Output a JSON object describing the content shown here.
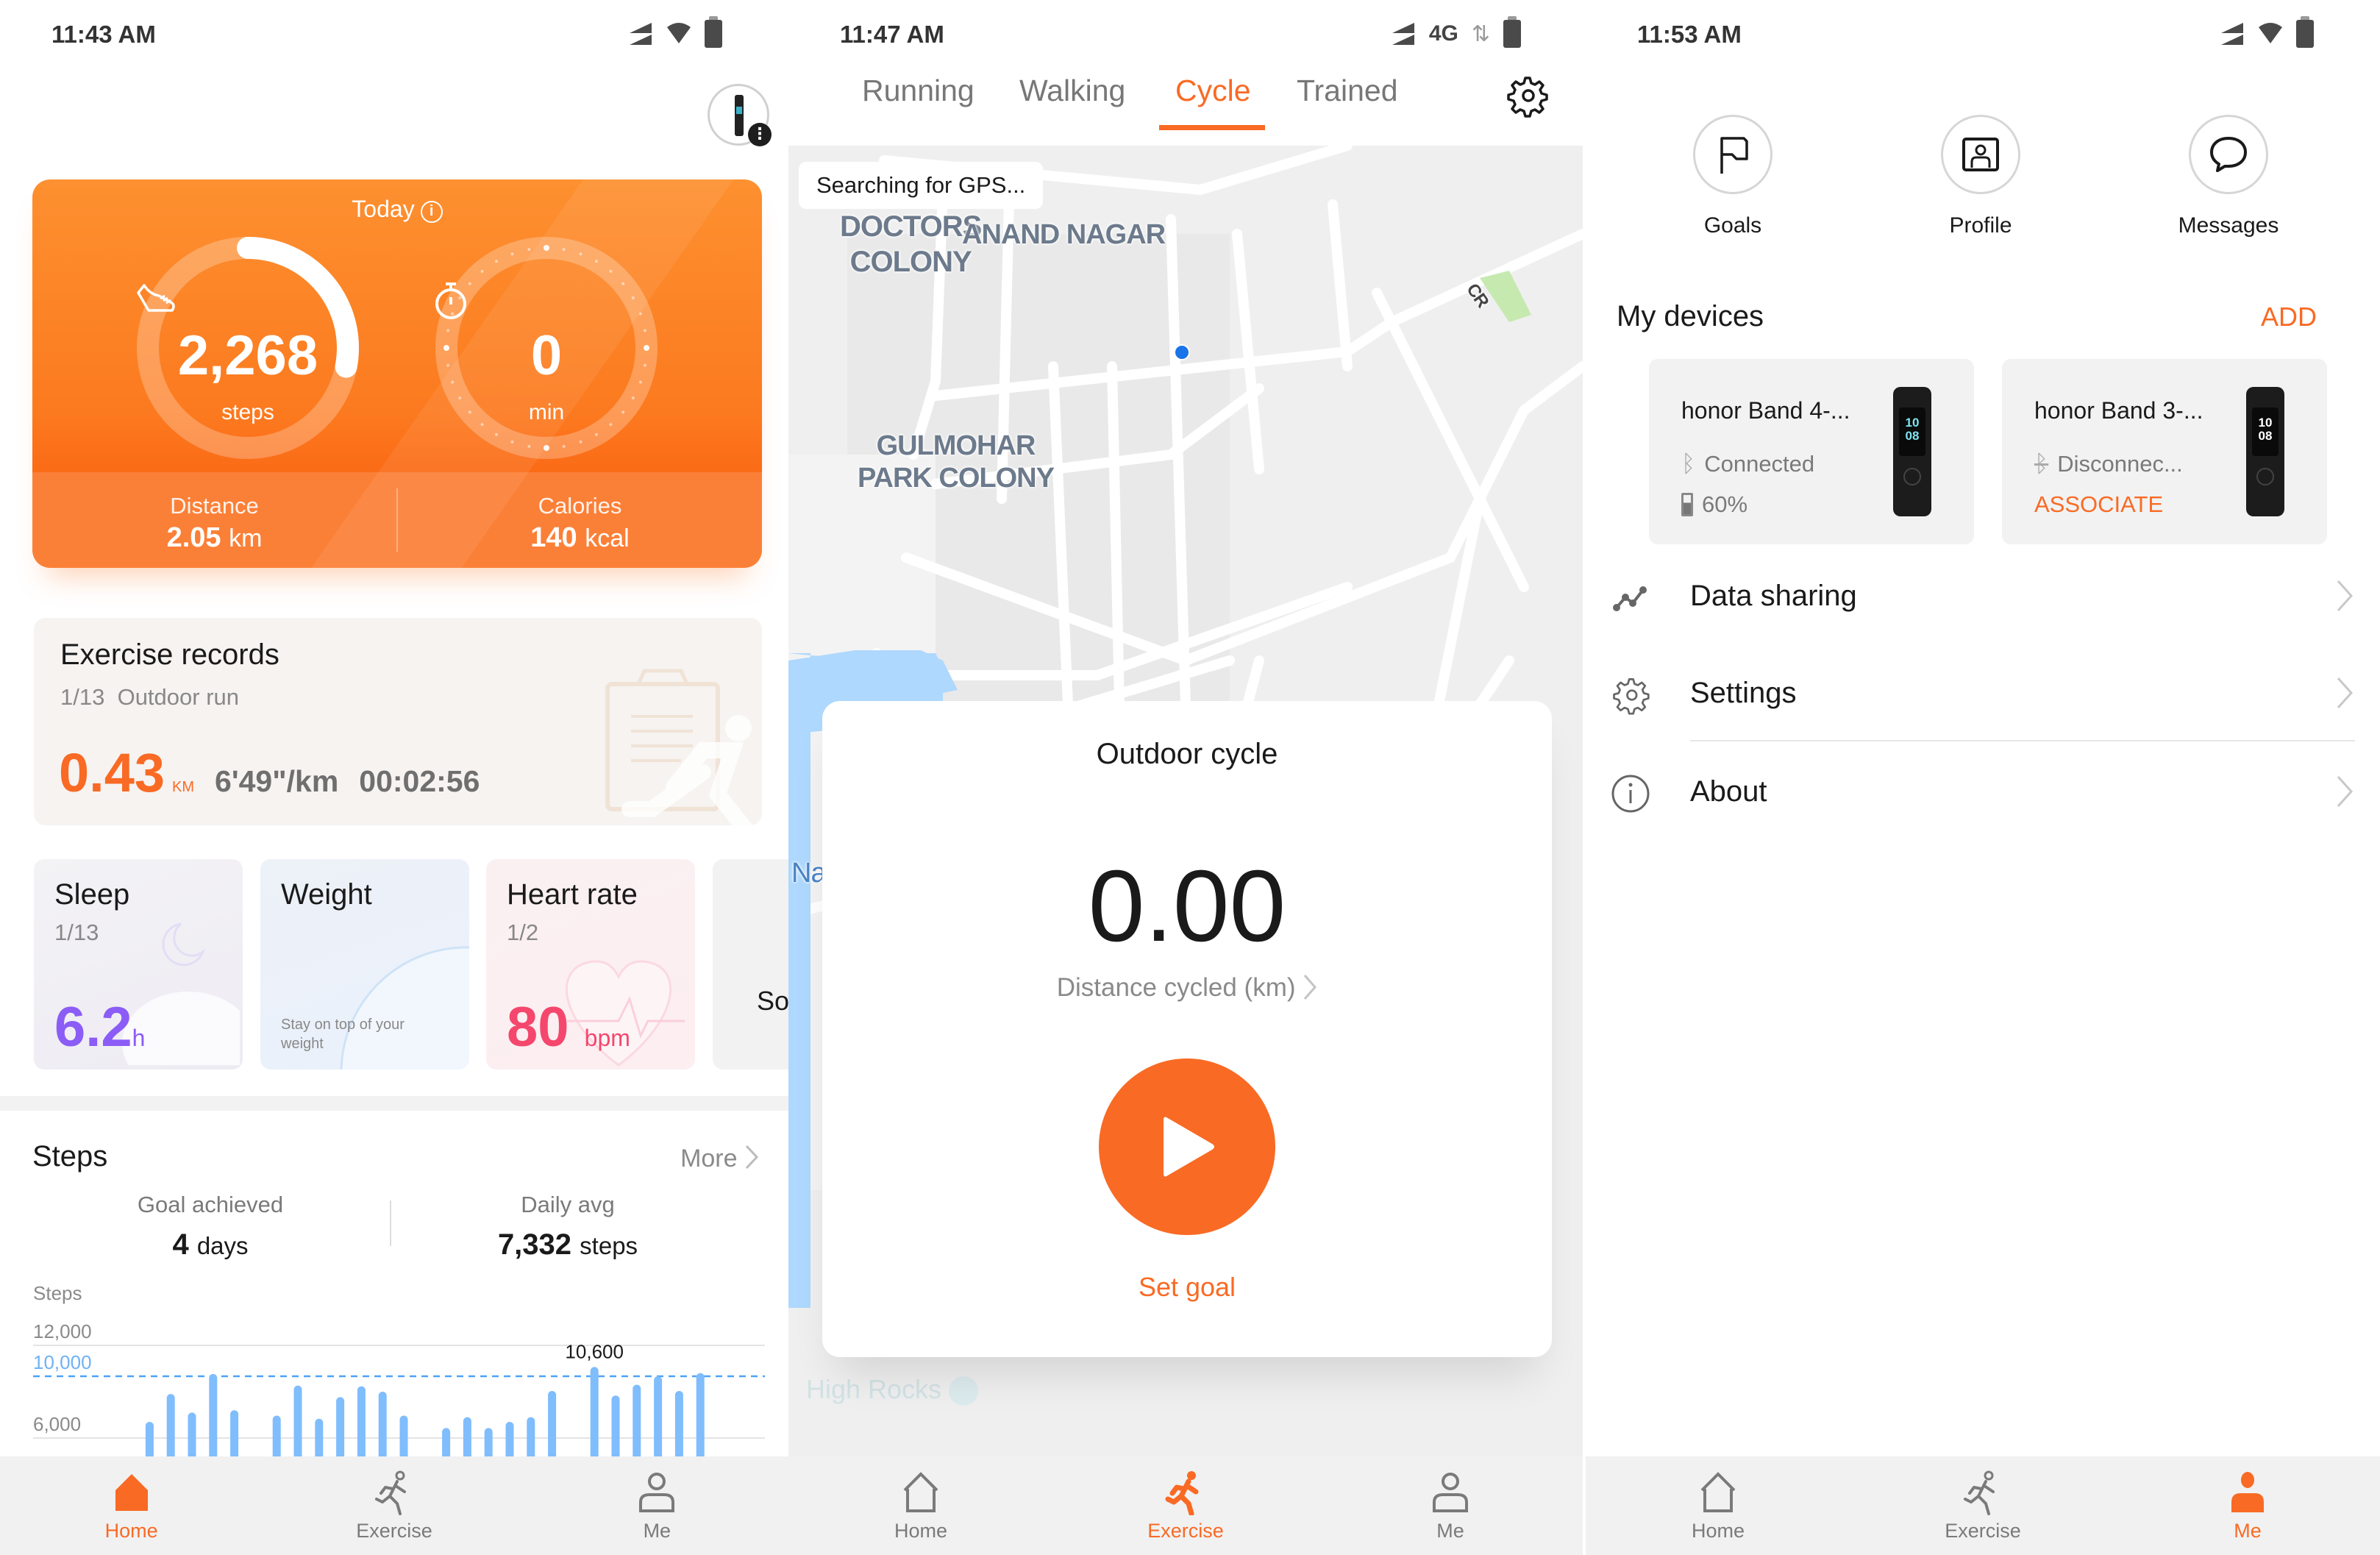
{
  "colors": {
    "accent": "#f96a24",
    "bar": "#7fbdfd",
    "goal_line": "#4da3f5",
    "sleep": "#8b5cf6",
    "heart": "#f5476d"
  },
  "panel_home": {
    "status": {
      "time": "11:43 AM"
    },
    "today": {
      "title": "Today",
      "steps_value": "2,268",
      "steps_unit": "steps",
      "steps_goal_progress": 0.28,
      "active_value": "0",
      "active_unit": "min",
      "distance_label": "Distance",
      "distance_value": "2.05",
      "distance_unit": "km",
      "calories_label": "Calories",
      "calories_value": "140",
      "calories_unit": "kcal"
    },
    "exercise": {
      "title": "Exercise records",
      "date": "1/13",
      "type": "Outdoor run",
      "distance": "0.43",
      "distance_unit": "KM",
      "pace": "6'49\"/km",
      "duration": "00:02:56"
    },
    "cards": [
      {
        "title": "Sleep",
        "date": "1/13",
        "value": "6.2",
        "unit": "h"
      },
      {
        "title": "Weight",
        "note": "Stay on top of your weight"
      },
      {
        "title": "Heart rate",
        "date": "1/2",
        "value": "80",
        "unit": "bpm"
      },
      {
        "title": "So"
      }
    ],
    "steps_section": {
      "title": "Steps",
      "more": "More",
      "goal_label": "Goal achieved",
      "goal_value": "4",
      "goal_unit": "days",
      "avg_label": "Daily avg",
      "avg_value": "7,332",
      "avg_unit": "steps"
    },
    "nav": [
      {
        "label": "Home",
        "active": true
      },
      {
        "label": "Exercise",
        "active": false
      },
      {
        "label": "Me",
        "active": false
      }
    ]
  },
  "chart_data": {
    "type": "bar",
    "title": "Steps",
    "ylabel": "Steps",
    "y_ticks": [
      "12,000",
      "10,000",
      "6,000"
    ],
    "y_tick_values": [
      12000,
      10000,
      6000
    ],
    "goal_line": 10000,
    "goal_label": "10,000",
    "ylim": [
      4000,
      12000
    ],
    "max_label": "10,600",
    "values": [
      null,
      null,
      null,
      null,
      null,
      7050,
      8850,
      7650,
      10150,
      7800,
      null,
      7450,
      9400,
      7250,
      8650,
      9350,
      9000,
      7450,
      null,
      6650,
      7350,
      6650,
      7050,
      7350,
      9050,
      null,
      10600,
      8750,
      9450,
      10000,
      9050,
      10200,
      null,
      null,
      null
    ],
    "grid": true
  },
  "panel_exercise": {
    "status": {
      "time": "11:47 AM",
      "network": "4G"
    },
    "tabs": [
      {
        "label": "Running",
        "active": false
      },
      {
        "label": "Walking",
        "active": false
      },
      {
        "label": "Cycle",
        "active": true
      },
      {
        "label": "Trained",
        "active": false
      }
    ],
    "gps_status": "Searching for GPS...",
    "map_labels": {
      "doctors_colony": "DOCTORS\nCOLONY",
      "anand_nagar": "ANAND NAGAR",
      "gulmohar": "GULMOHAR\nPARK COLONY",
      "road": "CR",
      "water": "Na",
      "poi": "High Rocks"
    },
    "card": {
      "title": "Outdoor cycle",
      "value": "0.00",
      "label": "Distance cycled (km)",
      "set_goal": "Set goal"
    },
    "nav": [
      {
        "label": "Home",
        "active": false
      },
      {
        "label": "Exercise",
        "active": true
      },
      {
        "label": "Me",
        "active": false
      }
    ]
  },
  "panel_me": {
    "status": {
      "time": "11:53 AM"
    },
    "quick": [
      {
        "label": "Goals",
        "icon": "flag-icon"
      },
      {
        "label": "Profile",
        "icon": "profile-card-icon"
      },
      {
        "label": "Messages",
        "icon": "chat-bubble-icon"
      }
    ],
    "devices_title": "My devices",
    "add_label": "ADD",
    "devices": [
      {
        "name": "honor Band 4-...",
        "status": "Connected",
        "battery": "60%",
        "screen": "10\n08"
      },
      {
        "name": "honor Band 3-...",
        "status": "Disconnec...",
        "action": "ASSOCIATE",
        "screen": "10\n08"
      }
    ],
    "menu": [
      {
        "label": "Data sharing",
        "icon": "data-sharing-icon"
      },
      {
        "label": "Settings",
        "icon": "settings-gear-icon"
      },
      {
        "label": "About",
        "icon": "info-icon"
      }
    ],
    "nav": [
      {
        "label": "Home",
        "active": false
      },
      {
        "label": "Exercise",
        "active": false
      },
      {
        "label": "Me",
        "active": true
      }
    ]
  }
}
